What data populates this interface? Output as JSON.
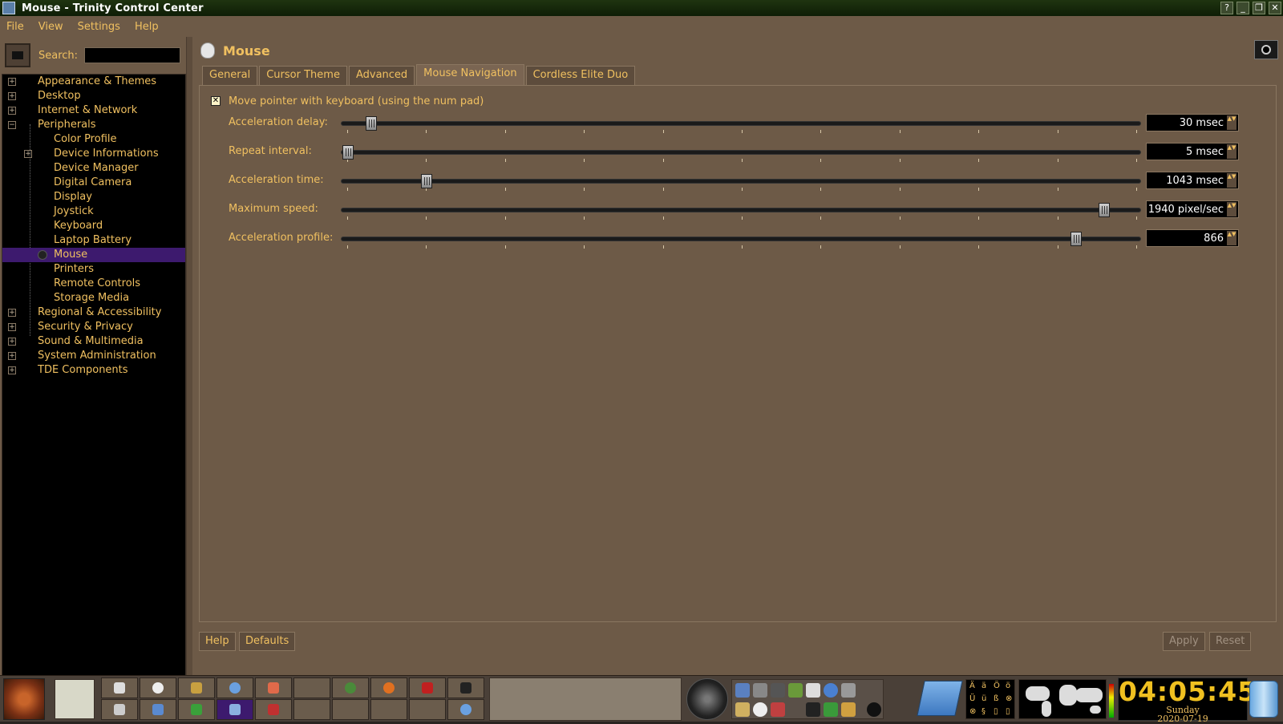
{
  "window": {
    "title": "Mouse - Trinity Control Center",
    "buttons": [
      "?",
      "_",
      "❐",
      "✕"
    ]
  },
  "menubar": {
    "items": [
      {
        "label": "File"
      },
      {
        "label": "View"
      },
      {
        "label": "Settings"
      },
      {
        "label": "Help"
      }
    ]
  },
  "sidebar": {
    "search_label": "Search:",
    "search_value": "",
    "tree": [
      {
        "label": "Appearance & Themes",
        "level": 0,
        "expander": "+"
      },
      {
        "label": "Desktop",
        "level": 0,
        "expander": "+"
      },
      {
        "label": "Internet & Network",
        "level": 0,
        "expander": "+"
      },
      {
        "label": "Peripherals",
        "level": 0,
        "expander": "−"
      },
      {
        "label": "Color Profile",
        "level": 1
      },
      {
        "label": "Device Informations",
        "level": 1,
        "expander": "+"
      },
      {
        "label": "Device Manager",
        "level": 1
      },
      {
        "label": "Digital Camera",
        "level": 1
      },
      {
        "label": "Display",
        "level": 1
      },
      {
        "label": "Joystick",
        "level": 1
      },
      {
        "label": "Keyboard",
        "level": 1
      },
      {
        "label": "Laptop Battery",
        "level": 1
      },
      {
        "label": "Mouse",
        "level": 1,
        "selected": true
      },
      {
        "label": "Printers",
        "level": 1
      },
      {
        "label": "Remote Controls",
        "level": 1
      },
      {
        "label": "Storage Media",
        "level": 1
      },
      {
        "label": "Regional & Accessibility",
        "level": 0,
        "expander": "+"
      },
      {
        "label": "Security & Privacy",
        "level": 0,
        "expander": "+"
      },
      {
        "label": "Sound & Multimedia",
        "level": 0,
        "expander": "+"
      },
      {
        "label": "System Administration",
        "level": 0,
        "expander": "+"
      },
      {
        "label": "TDE Components",
        "level": 0,
        "expander": "+"
      }
    ]
  },
  "main": {
    "title": "Mouse",
    "tabs": [
      {
        "label": "General",
        "active": false
      },
      {
        "label": "Cursor Theme",
        "active": false
      },
      {
        "label": "Advanced",
        "active": false
      },
      {
        "label": "Mouse Navigation",
        "active": true
      },
      {
        "label": "Cordless Elite Duo",
        "active": false
      }
    ],
    "checkbox": {
      "label": "Move pointer with keyboard (using the num pad)",
      "checked": true,
      "mark": "✕"
    },
    "sliders": [
      {
        "label": "Acceleration delay:",
        "value": "30 msec",
        "fraction": 0.03
      },
      {
        "label": "Repeat interval:",
        "value": "5 msec",
        "fraction": 0.0
      },
      {
        "label": "Acceleration time:",
        "value": "1043 msec",
        "fraction": 0.1
      },
      {
        "label": "Maximum speed:",
        "value": "1940 pixel/sec",
        "fraction": 0.96
      },
      {
        "label": "Acceleration profile:",
        "value": "866",
        "fraction": 0.925
      }
    ],
    "buttons": {
      "help": "Help",
      "defaults": "Defaults",
      "apply": "Apply",
      "reset": "Reset"
    }
  },
  "taskbar": {
    "clock": {
      "time": "04:05:45",
      "day": "Sunday",
      "date": "2020-07-19"
    },
    "keyboard_chars": [
      "Ä",
      "ä",
      "Ö",
      "ö",
      "Ü",
      "ü",
      "ß",
      "⊗",
      "⊗",
      "§",
      "▯",
      "▯"
    ],
    "colors": {
      "accent": "#f0c060",
      "selection": "#3d1a6e",
      "panel": "#6d5a47"
    }
  }
}
